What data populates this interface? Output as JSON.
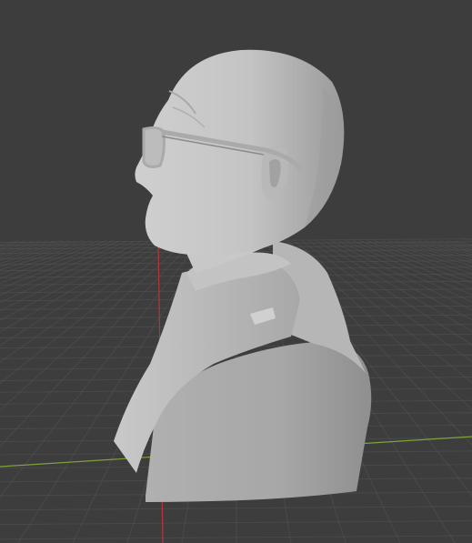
{
  "viewport": {
    "background_color": "#3d3d3d",
    "grid_color": "#545454",
    "x_axis_color": "#7fa33a",
    "y_axis_color": "#b0383d",
    "view": "perspective",
    "grid_visible": true
  },
  "object": {
    "type": "sculpted bust",
    "view_side": "left profile",
    "shading": "solid",
    "material_color": "#bdbdbd",
    "accessories": [
      "eyeglasses"
    ]
  }
}
